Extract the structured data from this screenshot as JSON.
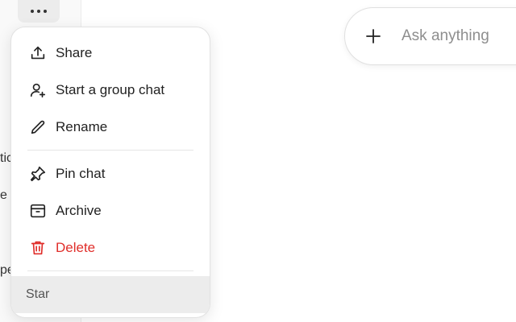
{
  "sidebar": {
    "fragments": [
      "tic",
      "e",
      "pe"
    ]
  },
  "menu": {
    "items": [
      {
        "label": "Share",
        "icon": "share-icon"
      },
      {
        "label": "Start a group chat",
        "icon": "add-user-icon"
      },
      {
        "label": "Rename",
        "icon": "pencil-icon"
      },
      {
        "label": "Pin chat",
        "icon": "pin-icon"
      },
      {
        "label": "Archive",
        "icon": "archive-icon"
      },
      {
        "label": "Delete",
        "icon": "trash-icon"
      },
      {
        "label": "Star"
      }
    ]
  },
  "composer": {
    "placeholder": "Ask anything"
  },
  "colors": {
    "delete": "#e02e2a",
    "highlight": "#ececec"
  }
}
